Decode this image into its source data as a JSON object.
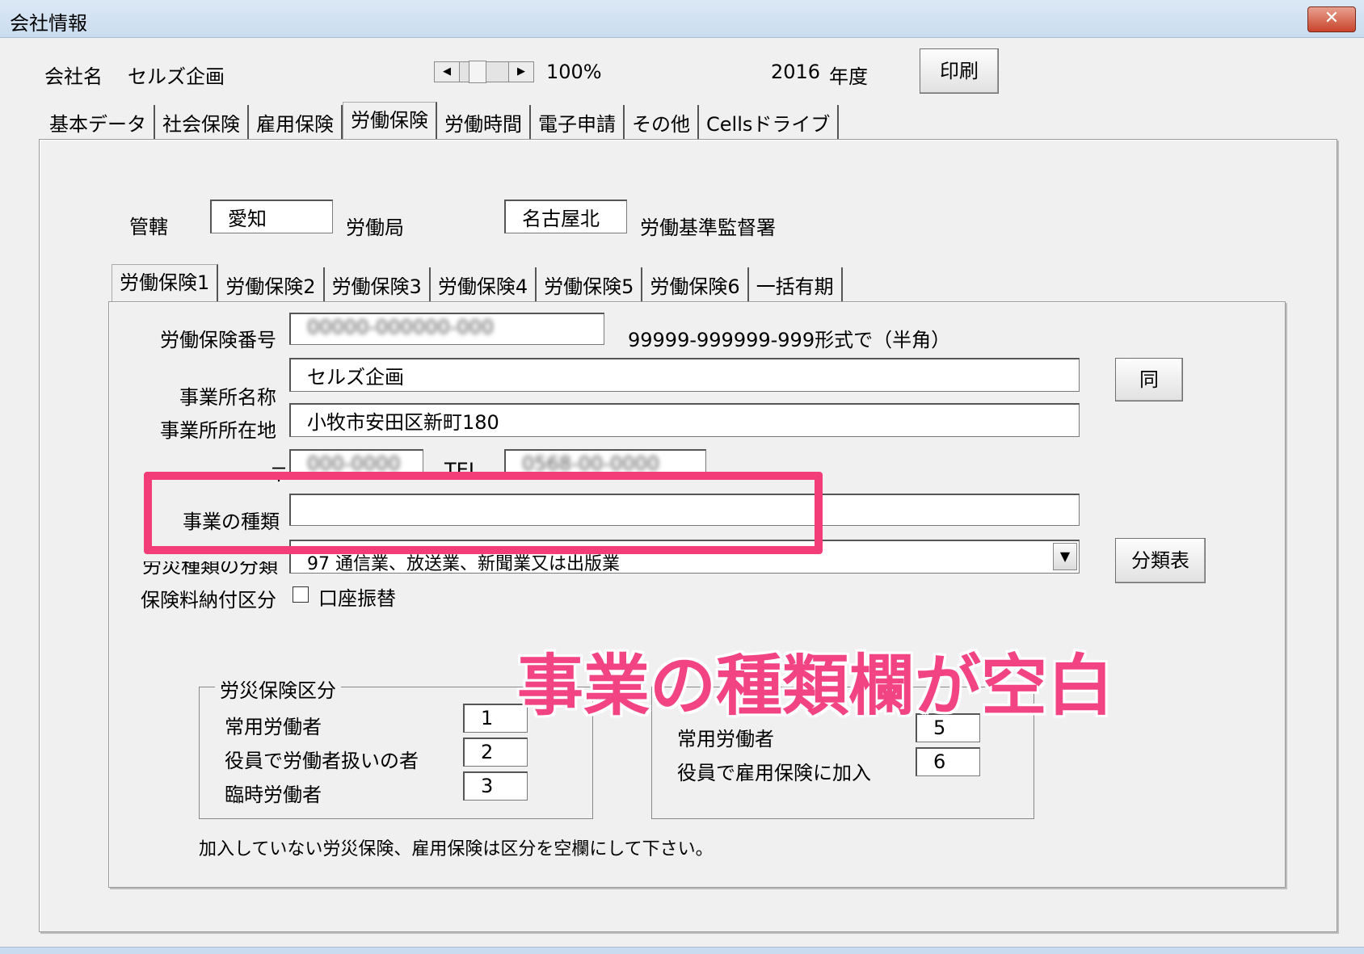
{
  "window": {
    "title": "会社情報",
    "close_glyph": "✕"
  },
  "header": {
    "company_label": "会社名",
    "company_name": "セルズ企画",
    "zoom_value": "100%",
    "year_value": "2016",
    "year_label": "年度",
    "print_button": "印刷"
  },
  "main_tabs": [
    "基本データ",
    "社会保険",
    "雇用保険",
    "労働保険",
    "労働時間",
    "電子申請",
    "その他",
    "Cellsドライブ"
  ],
  "jurisdiction": {
    "label": "管轄",
    "prefecture": "愛知",
    "bureau_label": "労働局",
    "office": "名古屋北",
    "office_label": "労働基準監督署"
  },
  "sub_tabs": [
    "労働保険1",
    "労働保険2",
    "労働保険3",
    "労働保険4",
    "労働保険5",
    "労働保険6",
    "一括有期"
  ],
  "form": {
    "insurance_no_label": "労働保険番号",
    "insurance_no_value": "00000-000000-000",
    "insurance_no_hint": "99999-999999-999形式で（半角）",
    "office_name_label": "事業所名称",
    "office_name_value": "セルズ企画",
    "same_button": "同",
    "address_label": "事業所所在地",
    "address_value": "小牧市安田区新町180",
    "postal_label": "〒",
    "postal_value": "000-0000",
    "tel_label": "TEL",
    "tel_value": "0568-00-0000",
    "business_type_label": "事業の種類",
    "business_type_value": "",
    "accident_class_label": "労災種類の分類",
    "accident_class_value": "97 通信業、放送業、新聞業又は出版業",
    "classification_button": "分類表",
    "payment_label": "保険料納付区分",
    "account_transfer_label": "口座振替"
  },
  "rousai_group": {
    "legend": "労災保険区分",
    "rows": [
      {
        "label": "常用労働者",
        "value": "1"
      },
      {
        "label": "役員で労働者扱いの者",
        "value": "2"
      },
      {
        "label": "臨時労働者",
        "value": "3"
      }
    ]
  },
  "koyou_group": {
    "rows": [
      {
        "label": "常用労働者",
        "value": "5"
      },
      {
        "label": "役員で雇用保険に加入",
        "value": "6"
      }
    ]
  },
  "footer_note": "加入していない労災保険、雇用保険は区分を空欄にして下さい。",
  "annotation": "事業の種類欄が空白",
  "colors": {
    "highlight": "#f23d78",
    "annotation": "#f24383"
  }
}
